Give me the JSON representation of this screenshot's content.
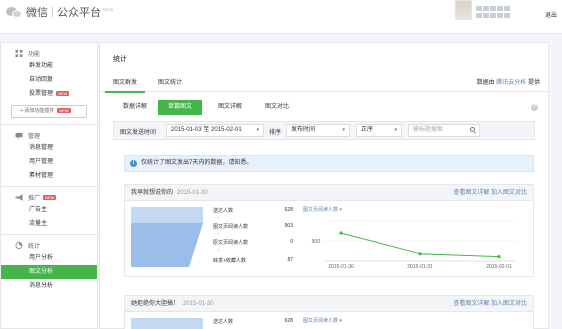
{
  "header": {
    "app_name": "微信",
    "platform": "公众平台",
    "badge": "BETA",
    "logout": "退出"
  },
  "sidebar": {
    "sections": [
      {
        "title": "功能",
        "icon": "grid-icon",
        "items": [
          {
            "label": "群发功能"
          },
          {
            "label": "自动回复"
          },
          {
            "label": "投票管理",
            "new": "NEW"
          }
        ]
      },
      {
        "title": "管理",
        "icon": "message-icon",
        "items": [
          {
            "label": "消息管理"
          },
          {
            "label": "用户管理"
          },
          {
            "label": "素材管理"
          }
        ]
      },
      {
        "title": "推广",
        "icon": "megaphone-icon",
        "new": "NEW",
        "items": [
          {
            "label": "广告主"
          },
          {
            "label": "流量主"
          }
        ]
      },
      {
        "title": "统计",
        "icon": "chart-icon",
        "items": [
          {
            "label": "用户分析"
          },
          {
            "label": "图文分析"
          },
          {
            "label": "消息分析"
          }
        ]
      }
    ],
    "add_plugin": "+ 添加功能插件",
    "add_plugin_badge": "NEW"
  },
  "main": {
    "title": "统计",
    "tabs": [
      "图文群发",
      "图文统计"
    ],
    "data_source_prefix": "数据由",
    "data_source_link": "腾讯云分析",
    "data_source_suffix": "提供",
    "subtabs": [
      "数据详解",
      "单篇图文",
      "图文详解",
      "图文对比"
    ],
    "filter": {
      "time_label": "图文发送时间",
      "date_range": "2015-01-03 至 2015-02-01",
      "sort_label": "排序",
      "sort_field": "发布时间",
      "order": "正序",
      "search_placeholder": "输标题搜索"
    },
    "notice": "仅统计了图文发出7天内的数据，请知悉。"
  },
  "cards": [
    {
      "title": "我早就想说你的",
      "date": "2015-01-30",
      "links": "查看图文详解  加入图文对比",
      "funnel": [
        {
          "label": "送达人数",
          "value": "628"
        },
        {
          "label": "图文页阅读人数",
          "value": "903"
        },
        {
          "label": "原文页阅读人数",
          "value": "0"
        },
        {
          "label": "转发+收藏人数",
          "value": "87"
        }
      ],
      "trend": {
        "title": "图文页阅读人数 ▾",
        "y_tick": "500",
        "x_ticks": [
          "2015-01-30",
          "2015-01-31",
          "2015-02-01"
        ]
      }
    },
    {
      "title": "她拒绝你大胆搞！",
      "date": "2015-01-30",
      "links": "查看图文详解  加入图文对比",
      "funnel": [
        {
          "label": "送达人数",
          "value": "628"
        }
      ],
      "trend": {
        "title": "图文页阅读人数 ▾"
      }
    }
  ],
  "chart_data": {
    "type": "line",
    "x": [
      "2015-01-30",
      "2015-01-31",
      "2015-02-01"
    ],
    "series": [
      {
        "values": [
          700,
          180,
          110
        ]
      }
    ],
    "ylim": [
      0,
      1000
    ],
    "ylabel": "",
    "grid": true,
    "color": "#44b549"
  }
}
